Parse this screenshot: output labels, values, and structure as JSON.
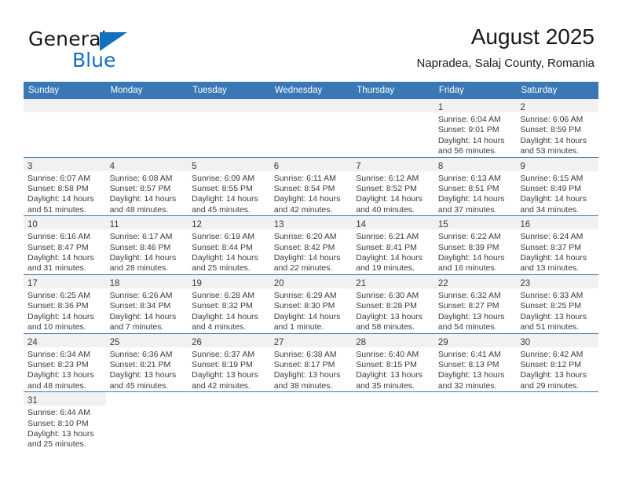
{
  "brand": {
    "name_part1": "General",
    "name_part2": "Blue"
  },
  "header": {
    "title": "August 2025",
    "subtitle": "Napradea, Salaj County, Romania"
  },
  "colors": {
    "header_blue": "#3a77b5",
    "logo_blue": "#1570bc",
    "daynum_band": "#f1f1f1",
    "text": "#3b3b3b"
  },
  "weekdays": [
    "Sunday",
    "Monday",
    "Tuesday",
    "Wednesday",
    "Thursday",
    "Friday",
    "Saturday"
  ],
  "weeks": [
    [
      {
        "day": "",
        "lines": [
          "",
          "",
          "",
          ""
        ]
      },
      {
        "day": "",
        "lines": [
          "",
          "",
          "",
          ""
        ]
      },
      {
        "day": "",
        "lines": [
          "",
          "",
          "",
          ""
        ]
      },
      {
        "day": "",
        "lines": [
          "",
          "",
          "",
          ""
        ]
      },
      {
        "day": "",
        "lines": [
          "",
          "",
          "",
          ""
        ]
      },
      {
        "day": "1",
        "lines": [
          "Sunrise: 6:04 AM",
          "Sunset: 9:01 PM",
          "Daylight: 14 hours",
          "and 56 minutes."
        ]
      },
      {
        "day": "2",
        "lines": [
          "Sunrise: 6:06 AM",
          "Sunset: 8:59 PM",
          "Daylight: 14 hours",
          "and 53 minutes."
        ]
      }
    ],
    [
      {
        "day": "3",
        "lines": [
          "Sunrise: 6:07 AM",
          "Sunset: 8:58 PM",
          "Daylight: 14 hours",
          "and 51 minutes."
        ]
      },
      {
        "day": "4",
        "lines": [
          "Sunrise: 6:08 AM",
          "Sunset: 8:57 PM",
          "Daylight: 14 hours",
          "and 48 minutes."
        ]
      },
      {
        "day": "5",
        "lines": [
          "Sunrise: 6:09 AM",
          "Sunset: 8:55 PM",
          "Daylight: 14 hours",
          "and 45 minutes."
        ]
      },
      {
        "day": "6",
        "lines": [
          "Sunrise: 6:11 AM",
          "Sunset: 8:54 PM",
          "Daylight: 14 hours",
          "and 42 minutes."
        ]
      },
      {
        "day": "7",
        "lines": [
          "Sunrise: 6:12 AM",
          "Sunset: 8:52 PM",
          "Daylight: 14 hours",
          "and 40 minutes."
        ]
      },
      {
        "day": "8",
        "lines": [
          "Sunrise: 6:13 AM",
          "Sunset: 8:51 PM",
          "Daylight: 14 hours",
          "and 37 minutes."
        ]
      },
      {
        "day": "9",
        "lines": [
          "Sunrise: 6:15 AM",
          "Sunset: 8:49 PM",
          "Daylight: 14 hours",
          "and 34 minutes."
        ]
      }
    ],
    [
      {
        "day": "10",
        "lines": [
          "Sunrise: 6:16 AM",
          "Sunset: 8:47 PM",
          "Daylight: 14 hours",
          "and 31 minutes."
        ]
      },
      {
        "day": "11",
        "lines": [
          "Sunrise: 6:17 AM",
          "Sunset: 8:46 PM",
          "Daylight: 14 hours",
          "and 28 minutes."
        ]
      },
      {
        "day": "12",
        "lines": [
          "Sunrise: 6:19 AM",
          "Sunset: 8:44 PM",
          "Daylight: 14 hours",
          "and 25 minutes."
        ]
      },
      {
        "day": "13",
        "lines": [
          "Sunrise: 6:20 AM",
          "Sunset: 8:42 PM",
          "Daylight: 14 hours",
          "and 22 minutes."
        ]
      },
      {
        "day": "14",
        "lines": [
          "Sunrise: 6:21 AM",
          "Sunset: 8:41 PM",
          "Daylight: 14 hours",
          "and 19 minutes."
        ]
      },
      {
        "day": "15",
        "lines": [
          "Sunrise: 6:22 AM",
          "Sunset: 8:39 PM",
          "Daylight: 14 hours",
          "and 16 minutes."
        ]
      },
      {
        "day": "16",
        "lines": [
          "Sunrise: 6:24 AM",
          "Sunset: 8:37 PM",
          "Daylight: 14 hours",
          "and 13 minutes."
        ]
      }
    ],
    [
      {
        "day": "17",
        "lines": [
          "Sunrise: 6:25 AM",
          "Sunset: 8:36 PM",
          "Daylight: 14 hours",
          "and 10 minutes."
        ]
      },
      {
        "day": "18",
        "lines": [
          "Sunrise: 6:26 AM",
          "Sunset: 8:34 PM",
          "Daylight: 14 hours",
          "and 7 minutes."
        ]
      },
      {
        "day": "19",
        "lines": [
          "Sunrise: 6:28 AM",
          "Sunset: 8:32 PM",
          "Daylight: 14 hours",
          "and 4 minutes."
        ]
      },
      {
        "day": "20",
        "lines": [
          "Sunrise: 6:29 AM",
          "Sunset: 8:30 PM",
          "Daylight: 14 hours",
          "and 1 minute."
        ]
      },
      {
        "day": "21",
        "lines": [
          "Sunrise: 6:30 AM",
          "Sunset: 8:28 PM",
          "Daylight: 13 hours",
          "and 58 minutes."
        ]
      },
      {
        "day": "22",
        "lines": [
          "Sunrise: 6:32 AM",
          "Sunset: 8:27 PM",
          "Daylight: 13 hours",
          "and 54 minutes."
        ]
      },
      {
        "day": "23",
        "lines": [
          "Sunrise: 6:33 AM",
          "Sunset: 8:25 PM",
          "Daylight: 13 hours",
          "and 51 minutes."
        ]
      }
    ],
    [
      {
        "day": "24",
        "lines": [
          "Sunrise: 6:34 AM",
          "Sunset: 8:23 PM",
          "Daylight: 13 hours",
          "and 48 minutes."
        ]
      },
      {
        "day": "25",
        "lines": [
          "Sunrise: 6:36 AM",
          "Sunset: 8:21 PM",
          "Daylight: 13 hours",
          "and 45 minutes."
        ]
      },
      {
        "day": "26",
        "lines": [
          "Sunrise: 6:37 AM",
          "Sunset: 8:19 PM",
          "Daylight: 13 hours",
          "and 42 minutes."
        ]
      },
      {
        "day": "27",
        "lines": [
          "Sunrise: 6:38 AM",
          "Sunset: 8:17 PM",
          "Daylight: 13 hours",
          "and 38 minutes."
        ]
      },
      {
        "day": "28",
        "lines": [
          "Sunrise: 6:40 AM",
          "Sunset: 8:15 PM",
          "Daylight: 13 hours",
          "and 35 minutes."
        ]
      },
      {
        "day": "29",
        "lines": [
          "Sunrise: 6:41 AM",
          "Sunset: 8:13 PM",
          "Daylight: 13 hours",
          "and 32 minutes."
        ]
      },
      {
        "day": "30",
        "lines": [
          "Sunrise: 6:42 AM",
          "Sunset: 8:12 PM",
          "Daylight: 13 hours",
          "and 29 minutes."
        ]
      }
    ],
    [
      {
        "day": "31",
        "lines": [
          "Sunrise: 6:44 AM",
          "Sunset: 8:10 PM",
          "Daylight: 13 hours",
          "and 25 minutes."
        ]
      },
      {
        "day": null,
        "lines": [
          "",
          "",
          "",
          ""
        ]
      },
      {
        "day": null,
        "lines": [
          "",
          "",
          "",
          ""
        ]
      },
      {
        "day": null,
        "lines": [
          "",
          "",
          "",
          ""
        ]
      },
      {
        "day": null,
        "lines": [
          "",
          "",
          "",
          ""
        ]
      },
      {
        "day": null,
        "lines": [
          "",
          "",
          "",
          ""
        ]
      },
      {
        "day": null,
        "lines": [
          "",
          "",
          "",
          ""
        ]
      }
    ]
  ]
}
